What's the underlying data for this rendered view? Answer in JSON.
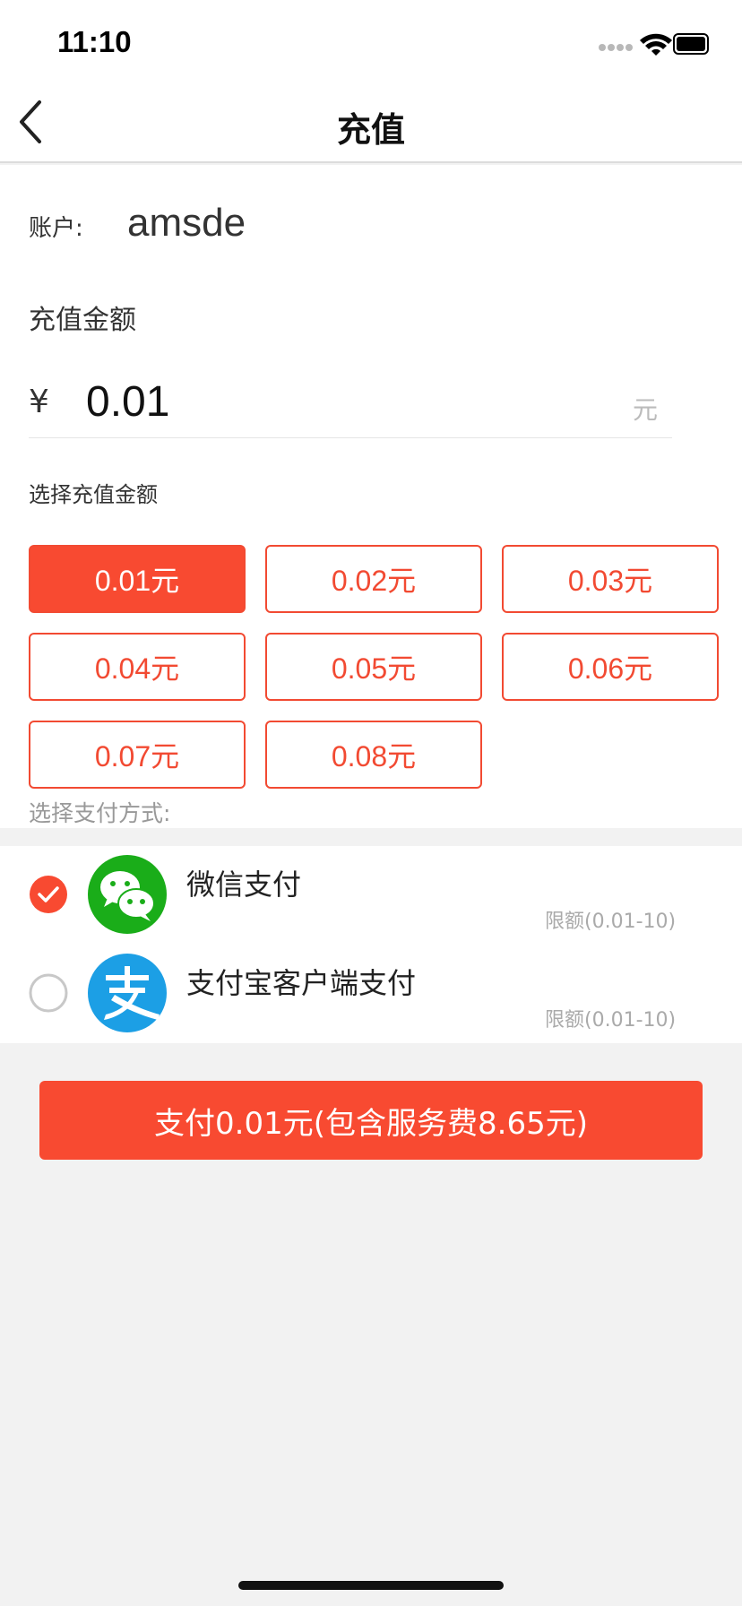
{
  "status_bar": {
    "time": "11:10",
    "icons": [
      "signal-icon",
      "wifi-icon",
      "battery-icon"
    ]
  },
  "nav": {
    "title": "充值",
    "back_icon": "chevron-left-icon"
  },
  "account": {
    "label": "账户:",
    "value": "amsde"
  },
  "amount": {
    "title": "充值金额",
    "currency_symbol": "¥",
    "value": "0.01",
    "unit": "元"
  },
  "choose_amount_label": "选择充值金额",
  "amount_options": [
    {
      "label": "0.01元",
      "selected": true
    },
    {
      "label": "0.02元",
      "selected": false
    },
    {
      "label": "0.03元",
      "selected": false
    },
    {
      "label": "0.04元",
      "selected": false
    },
    {
      "label": "0.05元",
      "selected": false
    },
    {
      "label": "0.06元",
      "selected": false
    },
    {
      "label": "0.07元",
      "selected": false
    },
    {
      "label": "0.08元",
      "selected": false
    }
  ],
  "choose_pay_label": "选择支付方式:",
  "payment_methods": [
    {
      "name": "微信支付",
      "limit": "限额(0.01-10)",
      "selected": true,
      "icon": "wechat-pay-icon"
    },
    {
      "name": "支付宝客户端支付",
      "limit": "限额(0.01-10)",
      "selected": false,
      "icon": "alipay-icon"
    }
  ],
  "pay_button": {
    "label": "支付0.01元(包含服务费8.65元)"
  },
  "colors": {
    "accent": "#f84a31",
    "wechat": "#1aad19",
    "alipay": "#1c9fe5"
  }
}
